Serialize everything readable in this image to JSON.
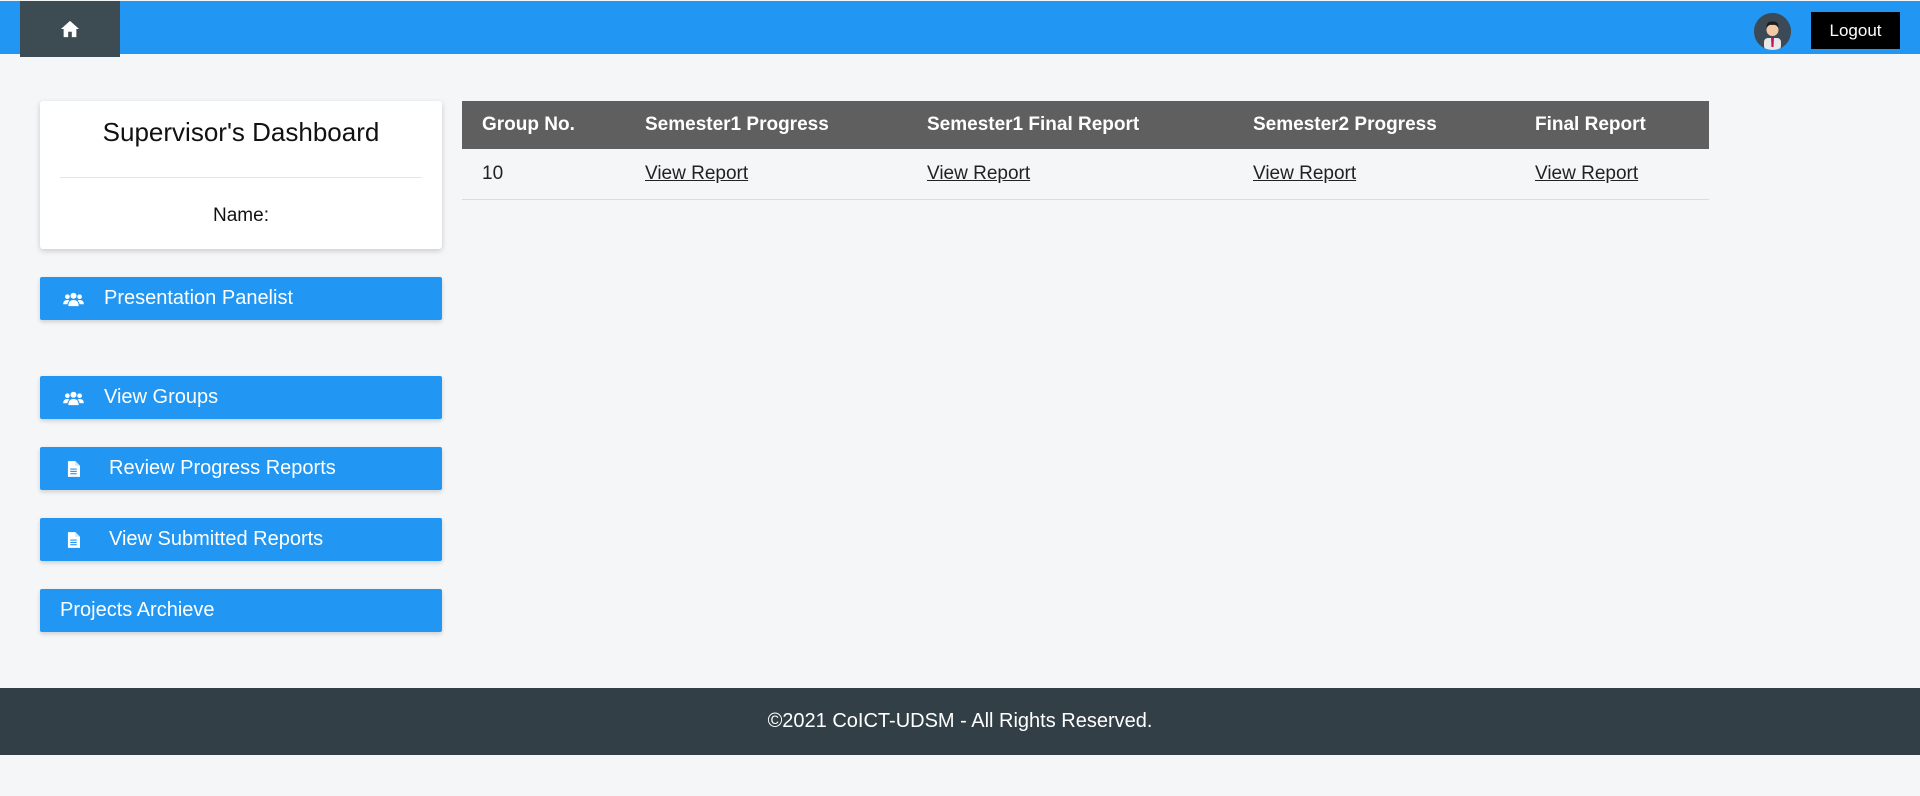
{
  "topbar": {
    "home_icon": "home-icon",
    "avatar_icon": "user-avatar",
    "logout_label": "Logout"
  },
  "sidebar": {
    "title": "Supervisor's Dashboard",
    "name_label": "Name:",
    "buttons": [
      {
        "label": "Presentation Panelist",
        "icon": "users-icon"
      },
      {
        "label": "View Groups",
        "icon": "users-icon"
      },
      {
        "label": "Review Progress Reports",
        "icon": "file-icon"
      },
      {
        "label": "View Submitted Reports",
        "icon": "file-icon"
      },
      {
        "label": "Projects Archieve",
        "icon": ""
      }
    ]
  },
  "table": {
    "headers": [
      "Group No.",
      "Semester1 Progress",
      "Semester1 Final Report",
      "Semester2 Progress",
      "Final Report"
    ],
    "rows": [
      [
        "10",
        "View Report",
        "View Report",
        "View Report",
        "View Report"
      ]
    ]
  },
  "footer": {
    "text": "©2021 CoICT-UDSM - All Rights Reserved."
  },
  "colors": {
    "primary": "#2196f3",
    "home_button": "#3d4b53",
    "table_header": "#5f5f5f",
    "footer": "#333f47",
    "background": "#f5f6f8"
  }
}
